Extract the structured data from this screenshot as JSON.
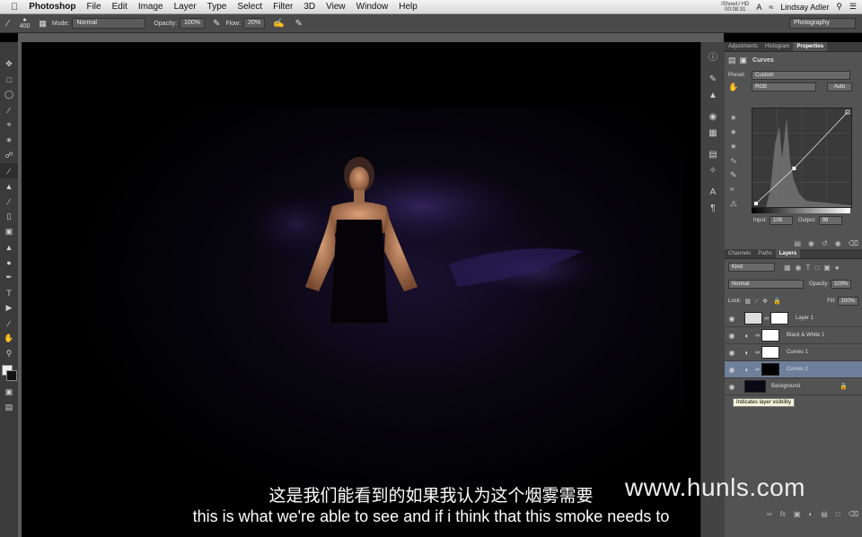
{
  "menubar": {
    "apple": "",
    "app": "Photoshop",
    "items": [
      "File",
      "Edit",
      "Image",
      "Layer",
      "Type",
      "Select",
      "Filter",
      "3D",
      "View",
      "Window",
      "Help"
    ],
    "status_line1": "iShowU HD",
    "status_line2": "00:08:31",
    "user": "Lindsay Adler"
  },
  "options": {
    "brush_size": "400",
    "mode_label": "Mode:",
    "mode_value": "Normal",
    "opacity_label": "Opacity:",
    "opacity_value": "100%",
    "flow_label": "Flow:",
    "flow_value": "20%",
    "workspace": "Photography"
  },
  "properties": {
    "tabs": [
      "Adjustments",
      "Histogram",
      "Properties"
    ],
    "title": "Curves",
    "preset_label": "Preset:",
    "preset_value": "Custom",
    "channel": "RGB",
    "auto": "Auto",
    "input_label": "Input:",
    "input_value": "106",
    "output_label": "Output:",
    "output_value": "98",
    "curve_point": {
      "input": 106,
      "output": 98
    }
  },
  "layers_panel": {
    "tabs": [
      "Channels",
      "Paths",
      "Layers"
    ],
    "filter": "Kind",
    "blend": "Normal",
    "opacity_label": "Opacity:",
    "opacity_value": "100%",
    "lock_label": "Lock:",
    "fill_label": "Fill:",
    "fill_value": "100%",
    "layers": [
      {
        "name": "Layer 1",
        "selected": false
      },
      {
        "name": "Black & White 1",
        "selected": false
      },
      {
        "name": "Curves 1",
        "selected": false
      },
      {
        "name": "Curves 2",
        "selected": true
      },
      {
        "name": "Background",
        "selected": false
      }
    ],
    "tooltip": "Indicates layer visibility"
  },
  "subtitles": {
    "cn": "这是我们能看到的如果我认为这个烟雾需要",
    "en": "this is what we're able to see and if i think that this smoke needs to"
  },
  "watermark": "www.hunls.com",
  "colors": {
    "accent": "#6d7f9a",
    "panel": "#535353"
  }
}
